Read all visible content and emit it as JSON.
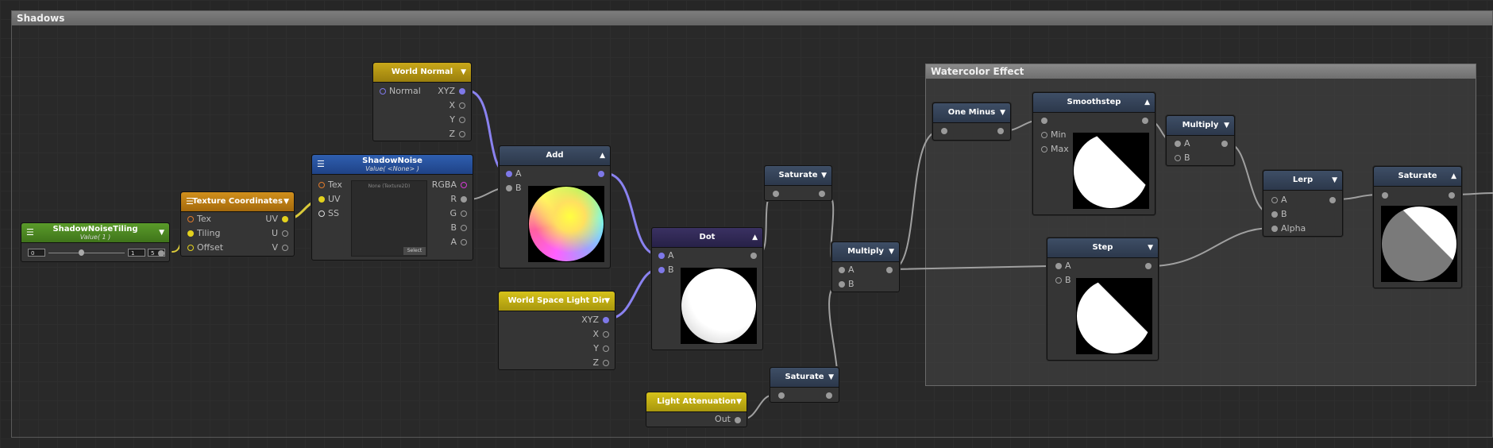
{
  "groups": {
    "shadows": "Shadows",
    "watercolor": "Watercolor Effect"
  },
  "nodes": {
    "tiling": {
      "title": "ShadowNoiseTiling",
      "subtitle": "Value( 1 )",
      "min": "0",
      "value": "1",
      "max": "5"
    },
    "texcoord": {
      "title": "Texture Coordinates",
      "ports_in": [
        "Tex",
        "Tiling",
        "Offset"
      ],
      "ports_out": [
        "UV",
        "U",
        "V"
      ]
    },
    "shadownoise": {
      "title": "ShadowNoise",
      "subtitle": "Value( <None> )",
      "ports_in": [
        "Tex",
        "UV",
        "SS"
      ],
      "ports_out": [
        "RGBA",
        "R",
        "G",
        "B",
        "A"
      ],
      "texture_label": "None (Texture2D)",
      "select_label": "Select"
    },
    "worldnormal": {
      "title": "World Normal",
      "port_in": "Normal",
      "ports_out": [
        "XYZ",
        "X",
        "Y",
        "Z"
      ]
    },
    "add": {
      "title": "Add",
      "ports_in": [
        "A",
        "B"
      ]
    },
    "lightdir": {
      "title": "World Space Light Dir",
      "ports_out": [
        "XYZ",
        "X",
        "Y",
        "Z"
      ]
    },
    "dot": {
      "title": "Dot",
      "ports_in": [
        "A",
        "B"
      ]
    },
    "saturate1": {
      "title": "Saturate"
    },
    "saturate2": {
      "title": "Saturate"
    },
    "lightatten": {
      "title": "Light Attenuation",
      "port_out": "Out"
    },
    "multiply1": {
      "title": "Multiply",
      "ports_in": [
        "A",
        "B"
      ]
    },
    "oneminus": {
      "title": "One Minus"
    },
    "smoothstep": {
      "title": "Smoothstep",
      "ports_in": [
        "Min",
        "Max"
      ]
    },
    "multiply2": {
      "title": "Multiply",
      "ports_in": [
        "A",
        "B"
      ]
    },
    "step": {
      "title": "Step",
      "ports_in": [
        "A",
        "B"
      ]
    },
    "lerp": {
      "title": "Lerp",
      "ports_in": [
        "A",
        "B",
        "Alpha"
      ]
    },
    "saturate3": {
      "title": "Saturate"
    }
  },
  "colors": {
    "port_purple": "#7e78e8",
    "port_yellow": "#e3d11d",
    "port_gray": "#9a9a9a",
    "wire_gray": "#a0a0a0",
    "wire_purple": "#8a82f0",
    "wire_yellow": "#d9c93a"
  },
  "icons": {
    "dropdown": "triangle-down-icon",
    "collapse": "triangle-up-icon",
    "menu": "hamburger-menu-icon"
  }
}
